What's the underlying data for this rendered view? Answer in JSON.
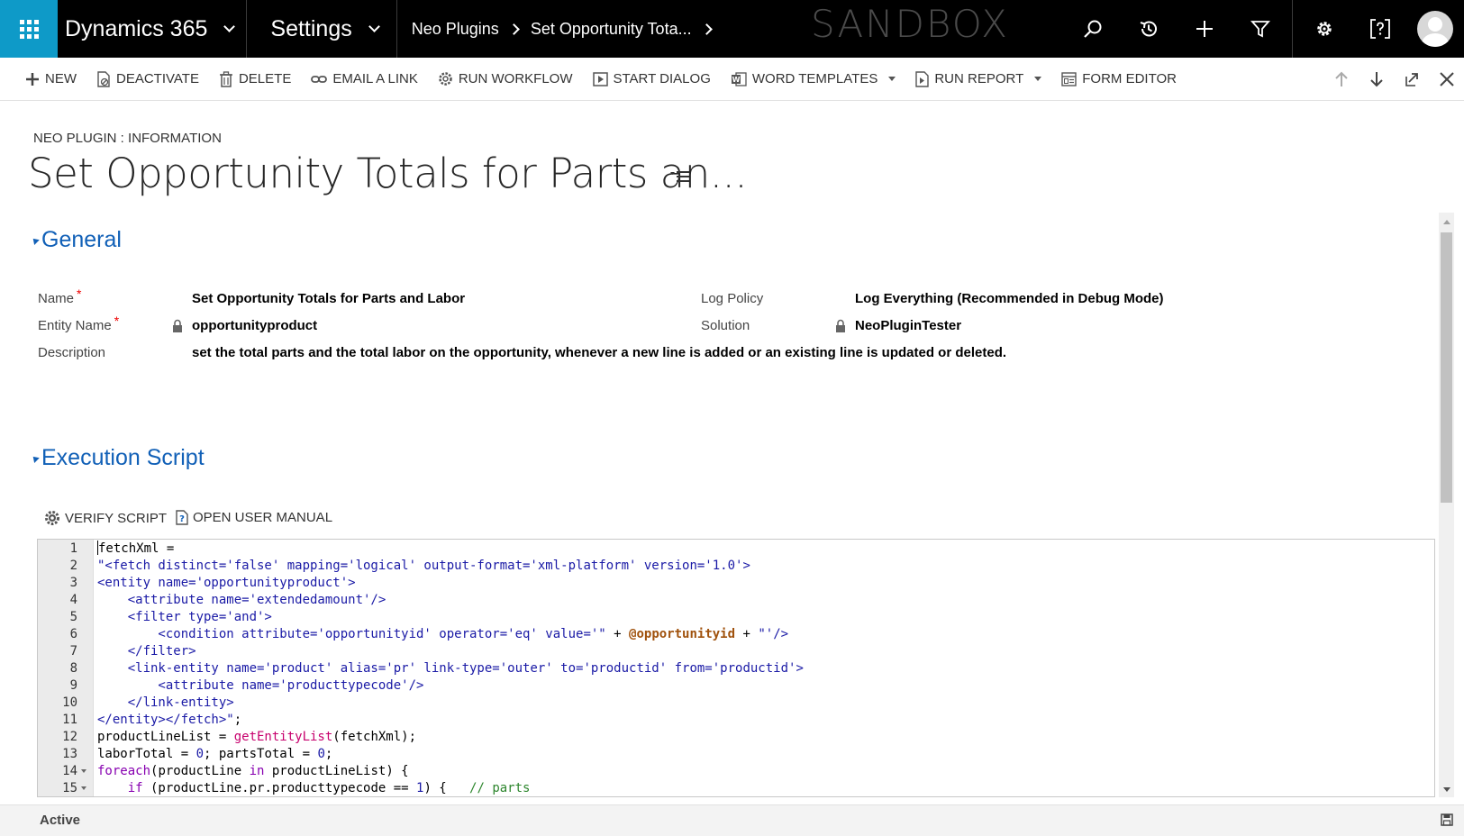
{
  "topnav": {
    "app_name": "Dynamics 365",
    "area": "Settings",
    "breadcrumbs": [
      "Neo Plugins",
      "Set Opportunity Tota..."
    ],
    "environment_label": "SANDBOX",
    "icons": [
      "search-icon",
      "recent-icon",
      "create-icon",
      "filter-icon",
      "settings-icon",
      "help-icon",
      "user-avatar"
    ]
  },
  "commandbar": {
    "new": "NEW",
    "deactivate": "DEACTIVATE",
    "delete": "DELETE",
    "email_link": "EMAIL A LINK",
    "run_workflow": "RUN WORKFLOW",
    "start_dialog": "START DIALOG",
    "word_templates": "WORD TEMPLATES",
    "run_report": "RUN REPORT",
    "form_editor": "FORM EDITOR"
  },
  "header": {
    "entity_label": "NEO PLUGIN : INFORMATION",
    "title": "Set Opportunity Totals for Parts an..."
  },
  "general": {
    "section_title": "General",
    "name_label": "Name",
    "name_value": "Set Opportunity Totals for Parts and Labor",
    "entity_label": "Entity Name",
    "entity_value": "opportunityproduct",
    "description_label": "Description",
    "description_value": "set the total parts and the total labor on the opportunity, whenever a new line is added or an existing line is updated or deleted.",
    "log_policy_label": "Log Policy",
    "log_policy_value": "Log Everything (Recommended in Debug Mode)",
    "solution_label": "Solution",
    "solution_value": "NeoPluginTester",
    "required_mark": "*"
  },
  "script": {
    "section_title": "Execution Script",
    "verify_label": "VERIFY SCRIPT",
    "manual_label": "OPEN USER MANUAL",
    "lines": [
      {
        "n": "1",
        "fold": false,
        "parts": [
          {
            "c": "def",
            "t": "fetchXml ="
          }
        ]
      },
      {
        "n": "2",
        "fold": false,
        "parts": [
          {
            "c": "str",
            "t": "\"<fetch distinct='false' mapping='logical' output-format='xml-platform' version='1.0'>"
          }
        ]
      },
      {
        "n": "3",
        "fold": false,
        "parts": [
          {
            "c": "str",
            "t": "<entity name='opportunityproduct'>"
          }
        ]
      },
      {
        "n": "4",
        "fold": false,
        "parts": [
          {
            "c": "str",
            "t": "    <attribute name='extendedamount'/>"
          }
        ]
      },
      {
        "n": "5",
        "fold": false,
        "parts": [
          {
            "c": "str",
            "t": "    <filter type='and'>"
          }
        ]
      },
      {
        "n": "6",
        "fold": false,
        "parts": [
          {
            "c": "str",
            "t": "        <condition attribute='opportunityid' operator='eq' value='\""
          },
          {
            "c": "def",
            "t": " + "
          },
          {
            "c": "var",
            "t": "@opportunityid"
          },
          {
            "c": "def",
            "t": " + "
          },
          {
            "c": "str",
            "t": "\"'/>"
          }
        ]
      },
      {
        "n": "7",
        "fold": false,
        "parts": [
          {
            "c": "str",
            "t": "    </filter>"
          }
        ]
      },
      {
        "n": "8",
        "fold": false,
        "parts": [
          {
            "c": "str",
            "t": "    <link-entity name='product' alias='pr' link-type='outer' to='productid' from='productid'>"
          }
        ]
      },
      {
        "n": "9",
        "fold": false,
        "parts": [
          {
            "c": "str",
            "t": "        <attribute name='producttypecode'/>"
          }
        ]
      },
      {
        "n": "10",
        "fold": false,
        "parts": [
          {
            "c": "str",
            "t": "    </link-entity>"
          }
        ]
      },
      {
        "n": "11",
        "fold": false,
        "parts": [
          {
            "c": "str",
            "t": "</entity></fetch>\""
          },
          {
            "c": "def",
            "t": ";"
          }
        ]
      },
      {
        "n": "12",
        "fold": false,
        "parts": [
          {
            "c": "def",
            "t": "productLineList = "
          },
          {
            "c": "fn",
            "t": "getEntityList"
          },
          {
            "c": "def",
            "t": "(fetchXml);"
          }
        ]
      },
      {
        "n": "13",
        "fold": false,
        "parts": [
          {
            "c": "def",
            "t": "laborTotal = "
          },
          {
            "c": "num",
            "t": "0"
          },
          {
            "c": "def",
            "t": "; partsTotal = "
          },
          {
            "c": "num",
            "t": "0"
          },
          {
            "c": "def",
            "t": ";"
          }
        ]
      },
      {
        "n": "14",
        "fold": true,
        "parts": [
          {
            "c": "kw",
            "t": "foreach"
          },
          {
            "c": "def",
            "t": "(productLine "
          },
          {
            "c": "kw",
            "t": "in"
          },
          {
            "c": "def",
            "t": " productLineList) {"
          }
        ]
      },
      {
        "n": "15",
        "fold": true,
        "parts": [
          {
            "c": "def",
            "t": "    "
          },
          {
            "c": "kw",
            "t": "if"
          },
          {
            "c": "def",
            "t": " (productLine.pr.producttypecode == "
          },
          {
            "c": "num",
            "t": "1"
          },
          {
            "c": "def",
            "t": ") {   "
          },
          {
            "c": "cmt",
            "t": "// parts"
          }
        ]
      }
    ]
  },
  "status": {
    "text": "Active"
  }
}
